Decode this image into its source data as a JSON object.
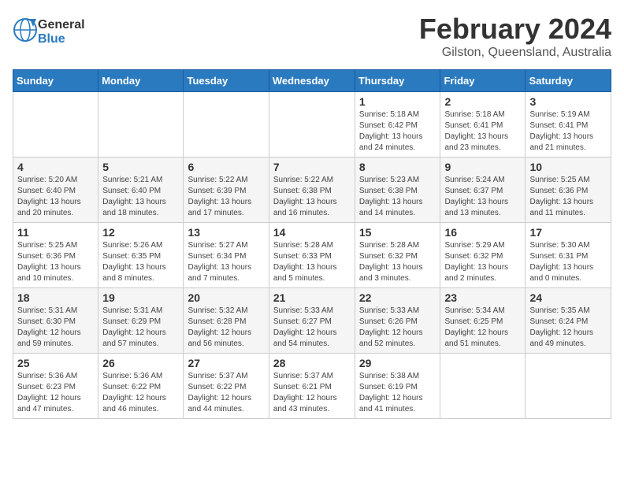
{
  "header": {
    "logo_general": "General",
    "logo_blue": "Blue",
    "month_year": "February 2024",
    "location": "Gilston, Queensland, Australia"
  },
  "calendar": {
    "weekdays": [
      "Sunday",
      "Monday",
      "Tuesday",
      "Wednesday",
      "Thursday",
      "Friday",
      "Saturday"
    ],
    "weeks": [
      [
        {
          "day": "",
          "info": ""
        },
        {
          "day": "",
          "info": ""
        },
        {
          "day": "",
          "info": ""
        },
        {
          "day": "",
          "info": ""
        },
        {
          "day": "1",
          "info": "Sunrise: 5:18 AM\nSunset: 6:42 PM\nDaylight: 13 hours\nand 24 minutes."
        },
        {
          "day": "2",
          "info": "Sunrise: 5:18 AM\nSunset: 6:41 PM\nDaylight: 13 hours\nand 23 minutes."
        },
        {
          "day": "3",
          "info": "Sunrise: 5:19 AM\nSunset: 6:41 PM\nDaylight: 13 hours\nand 21 minutes."
        }
      ],
      [
        {
          "day": "4",
          "info": "Sunrise: 5:20 AM\nSunset: 6:40 PM\nDaylight: 13 hours\nand 20 minutes."
        },
        {
          "day": "5",
          "info": "Sunrise: 5:21 AM\nSunset: 6:40 PM\nDaylight: 13 hours\nand 18 minutes."
        },
        {
          "day": "6",
          "info": "Sunrise: 5:22 AM\nSunset: 6:39 PM\nDaylight: 13 hours\nand 17 minutes."
        },
        {
          "day": "7",
          "info": "Sunrise: 5:22 AM\nSunset: 6:38 PM\nDaylight: 13 hours\nand 16 minutes."
        },
        {
          "day": "8",
          "info": "Sunrise: 5:23 AM\nSunset: 6:38 PM\nDaylight: 13 hours\nand 14 minutes."
        },
        {
          "day": "9",
          "info": "Sunrise: 5:24 AM\nSunset: 6:37 PM\nDaylight: 13 hours\nand 13 minutes."
        },
        {
          "day": "10",
          "info": "Sunrise: 5:25 AM\nSunset: 6:36 PM\nDaylight: 13 hours\nand 11 minutes."
        }
      ],
      [
        {
          "day": "11",
          "info": "Sunrise: 5:25 AM\nSunset: 6:36 PM\nDaylight: 13 hours\nand 10 minutes."
        },
        {
          "day": "12",
          "info": "Sunrise: 5:26 AM\nSunset: 6:35 PM\nDaylight: 13 hours\nand 8 minutes."
        },
        {
          "day": "13",
          "info": "Sunrise: 5:27 AM\nSunset: 6:34 PM\nDaylight: 13 hours\nand 7 minutes."
        },
        {
          "day": "14",
          "info": "Sunrise: 5:28 AM\nSunset: 6:33 PM\nDaylight: 13 hours\nand 5 minutes."
        },
        {
          "day": "15",
          "info": "Sunrise: 5:28 AM\nSunset: 6:32 PM\nDaylight: 13 hours\nand 3 minutes."
        },
        {
          "day": "16",
          "info": "Sunrise: 5:29 AM\nSunset: 6:32 PM\nDaylight: 13 hours\nand 2 minutes."
        },
        {
          "day": "17",
          "info": "Sunrise: 5:30 AM\nSunset: 6:31 PM\nDaylight: 13 hours\nand 0 minutes."
        }
      ],
      [
        {
          "day": "18",
          "info": "Sunrise: 5:31 AM\nSunset: 6:30 PM\nDaylight: 12 hours\nand 59 minutes."
        },
        {
          "day": "19",
          "info": "Sunrise: 5:31 AM\nSunset: 6:29 PM\nDaylight: 12 hours\nand 57 minutes."
        },
        {
          "day": "20",
          "info": "Sunrise: 5:32 AM\nSunset: 6:28 PM\nDaylight: 12 hours\nand 56 minutes."
        },
        {
          "day": "21",
          "info": "Sunrise: 5:33 AM\nSunset: 6:27 PM\nDaylight: 12 hours\nand 54 minutes."
        },
        {
          "day": "22",
          "info": "Sunrise: 5:33 AM\nSunset: 6:26 PM\nDaylight: 12 hours\nand 52 minutes."
        },
        {
          "day": "23",
          "info": "Sunrise: 5:34 AM\nSunset: 6:25 PM\nDaylight: 12 hours\nand 51 minutes."
        },
        {
          "day": "24",
          "info": "Sunrise: 5:35 AM\nSunset: 6:24 PM\nDaylight: 12 hours\nand 49 minutes."
        }
      ],
      [
        {
          "day": "25",
          "info": "Sunrise: 5:36 AM\nSunset: 6:23 PM\nDaylight: 12 hours\nand 47 minutes."
        },
        {
          "day": "26",
          "info": "Sunrise: 5:36 AM\nSunset: 6:22 PM\nDaylight: 12 hours\nand 46 minutes."
        },
        {
          "day": "27",
          "info": "Sunrise: 5:37 AM\nSunset: 6:22 PM\nDaylight: 12 hours\nand 44 minutes."
        },
        {
          "day": "28",
          "info": "Sunrise: 5:37 AM\nSunset: 6:21 PM\nDaylight: 12 hours\nand 43 minutes."
        },
        {
          "day": "29",
          "info": "Sunrise: 5:38 AM\nSunset: 6:19 PM\nDaylight: 12 hours\nand 41 minutes."
        },
        {
          "day": "",
          "info": ""
        },
        {
          "day": "",
          "info": ""
        }
      ]
    ]
  }
}
